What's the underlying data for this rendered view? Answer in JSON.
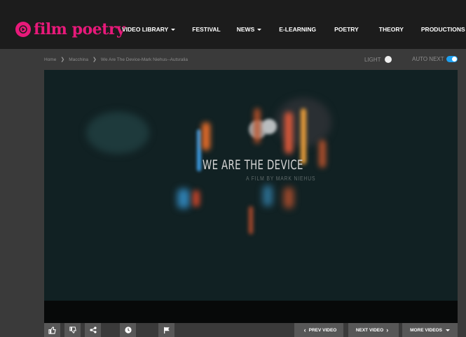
{
  "brand": {
    "name": "film poetry"
  },
  "nav": {
    "items": [
      {
        "label": "VIDEO LIBRARY",
        "has_dropdown": true
      },
      {
        "label": "FESTIVAL",
        "has_dropdown": false
      },
      {
        "label": "NEWS",
        "has_dropdown": true
      },
      {
        "label": "E-LEARNING",
        "has_dropdown": false
      },
      {
        "label": "POETRY",
        "has_dropdown": false
      },
      {
        "label": "THEORY",
        "has_dropdown": false
      },
      {
        "label": "PRODUCTIONS",
        "has_dropdown": false
      }
    ]
  },
  "breadcrumb": {
    "items": [
      "Home",
      "Macchina",
      "We Are The Device-Mark Niehus--Autsralia"
    ]
  },
  "toggles": {
    "light_label": "LIGHT",
    "autonext_label": "AUTO NEXT",
    "autonext_on": true
  },
  "video": {
    "title": "WE ARE THE DEVICE",
    "subtitle": "A FILM BY MARK NIEHUS"
  },
  "controls": {
    "prev_label": "PREV VIDEO",
    "next_label": "NEXT VIDEO",
    "more_label": "MORE VIDEOS"
  },
  "colors": {
    "brand_pink": "#e8197a",
    "header_bg": "#1c1c1c",
    "page_bg": "#3a3a3a",
    "toggle_blue": "#1ea0f0"
  },
  "icons": [
    "play-logo-icon",
    "thumbs-up-icon",
    "thumbs-down-icon",
    "share-icon",
    "clock-icon",
    "flag-icon",
    "bulb-icon"
  ]
}
